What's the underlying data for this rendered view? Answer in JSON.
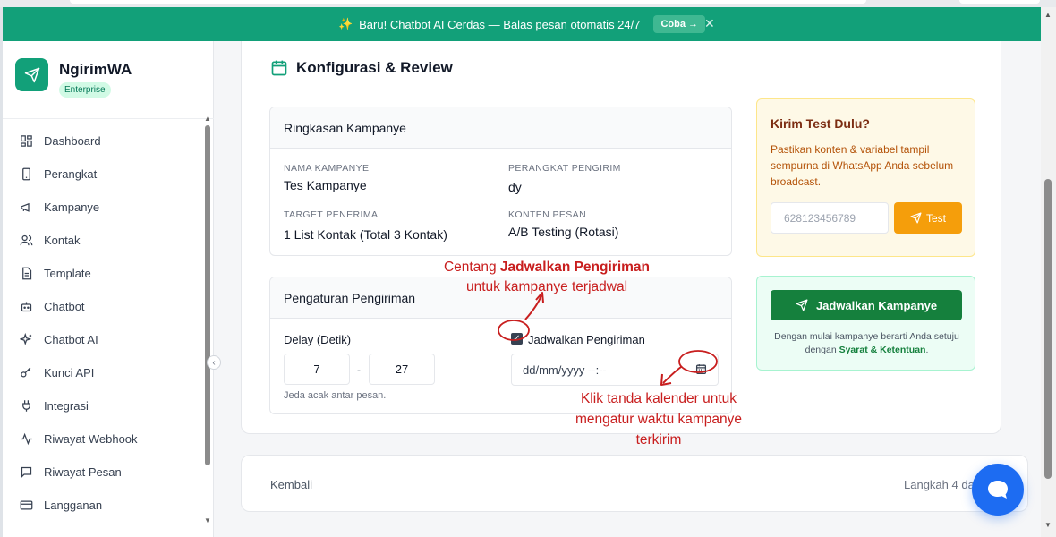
{
  "banner": {
    "spark_icon": "sparkle-icon",
    "text": "Baru! Chatbot AI Cerdas — Balas pesan otomatis 24/7",
    "cta": "Coba →"
  },
  "brand": {
    "name": "NgirimWA",
    "badge": "Enterprise"
  },
  "nav": [
    {
      "label": "Dashboard",
      "icon": "grid-icon"
    },
    {
      "label": "Perangkat",
      "icon": "phone-icon"
    },
    {
      "label": "Kampanye",
      "icon": "megaphone-icon"
    },
    {
      "label": "Kontak",
      "icon": "users-icon"
    },
    {
      "label": "Template",
      "icon": "document-icon"
    },
    {
      "label": "Chatbot",
      "icon": "bot-icon"
    },
    {
      "label": "Chatbot AI",
      "icon": "sparkle-icon"
    },
    {
      "label": "Kunci API",
      "icon": "key-icon"
    },
    {
      "label": "Integrasi",
      "icon": "plug-icon"
    },
    {
      "label": "Riwayat Webhook",
      "icon": "activity-icon"
    },
    {
      "label": "Riwayat Pesan",
      "icon": "message-icon"
    },
    {
      "label": "Langganan",
      "icon": "card-icon"
    }
  ],
  "main": {
    "title": "Konfigurasi & Review",
    "summary": {
      "heading": "Ringkasan Kampanye",
      "campaign_name_label": "NAMA KAMPANYE",
      "campaign_name": "Tes Kampanye",
      "device_label": "PERANGKAT PENGIRIM",
      "device": "dy",
      "target_label": "TARGET PENERIMA",
      "target": "1 List Kontak (Total 3 Kontak)",
      "content_label": "KONTEN PESAN",
      "content": "A/B Testing (Rotasi)"
    },
    "settings": {
      "heading": "Pengaturan Pengiriman",
      "delay_label": "Delay (Detik)",
      "delay_min": "7",
      "delay_sep": "-",
      "delay_max": "27",
      "delay_hint": "Jeda acak antar pesan.",
      "schedule_label": "Jadwalkan Pengiriman",
      "schedule_checked": true,
      "date_placeholder": "dd/mm/yyyy --:--"
    }
  },
  "annotations": {
    "top_prefix": "Centang ",
    "top_bold": "Jadwalkan Pengiriman",
    "top_line2": "untuk kampanye terjadwal",
    "bottom_line1": "Klik tanda kalender untuk",
    "bottom_line2": "mengatur waktu kampanye",
    "bottom_line3": "terkirim"
  },
  "test_panel": {
    "title": "Kirim Test Dulu?",
    "desc": "Pastikan konten & variabel tampil sempurna di WhatsApp Anda sebelum broadcast.",
    "phone_placeholder": "628123456789",
    "button": "Test"
  },
  "schedule_panel": {
    "button": "Jadwalkan Kampanye",
    "note_prefix": "Dengan mulai kampanye berarti Anda setuju dengan ",
    "note_link": "Syarat & Ketentuan",
    "note_suffix": "."
  },
  "footer": {
    "back": "Kembali",
    "step": "Langkah 4 da"
  },
  "colors": {
    "brand": "#12a079",
    "accent_orange": "#f59e0b",
    "cta_green": "#15803d",
    "annotation_red": "#c81e1e",
    "chat_blue": "#1d6cf2"
  }
}
